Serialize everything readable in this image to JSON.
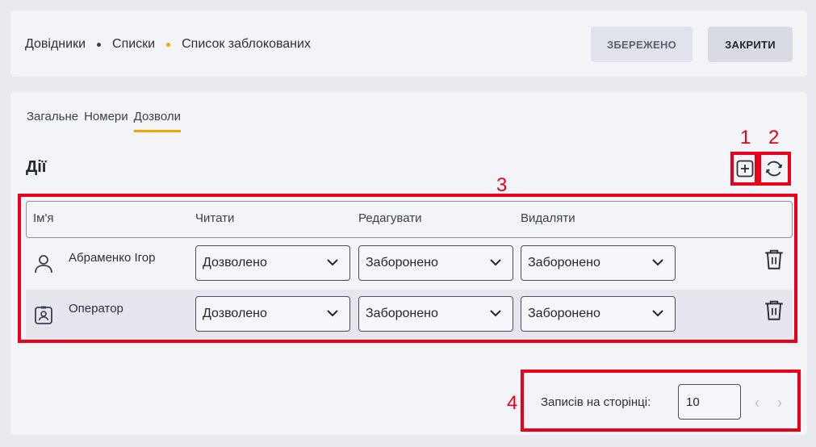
{
  "breadcrumb": {
    "items": [
      "Довідники",
      "Списки",
      "Список заблокованих"
    ],
    "dot_colors": [
      "#3a3f4c",
      "#f0a500"
    ]
  },
  "header": {
    "saved_label": "ЗБЕРЕЖЕНО",
    "close_label": "ЗАКРИТИ"
  },
  "tabs": [
    {
      "label": "Загальне"
    },
    {
      "label": "Номери"
    },
    {
      "label": "Дозволи",
      "active": true
    }
  ],
  "section_title": "Дії",
  "toolbar": {
    "add_icon": "plus-square-icon",
    "refresh_icon": "refresh-icon"
  },
  "table": {
    "headers": [
      "Ім'я",
      "Читати",
      "Редагувати",
      "Видаляти"
    ],
    "rows": [
      {
        "icon": "user-icon",
        "name": "Абраменко Ігор",
        "read": "Дозволено",
        "edit": "Заборонено",
        "delete": "Заборонено"
      },
      {
        "icon": "badge-icon",
        "name": "Оператор",
        "read": "Дозволено",
        "edit": "Заборонено",
        "delete": "Заборонено"
      }
    ]
  },
  "pagination": {
    "label": "Записів на сторінці:",
    "per_page": "10"
  },
  "annotations": [
    "1",
    "2",
    "3",
    "4"
  ],
  "colors": {
    "accent": "#f0a500",
    "annotation": "#e8001c"
  }
}
